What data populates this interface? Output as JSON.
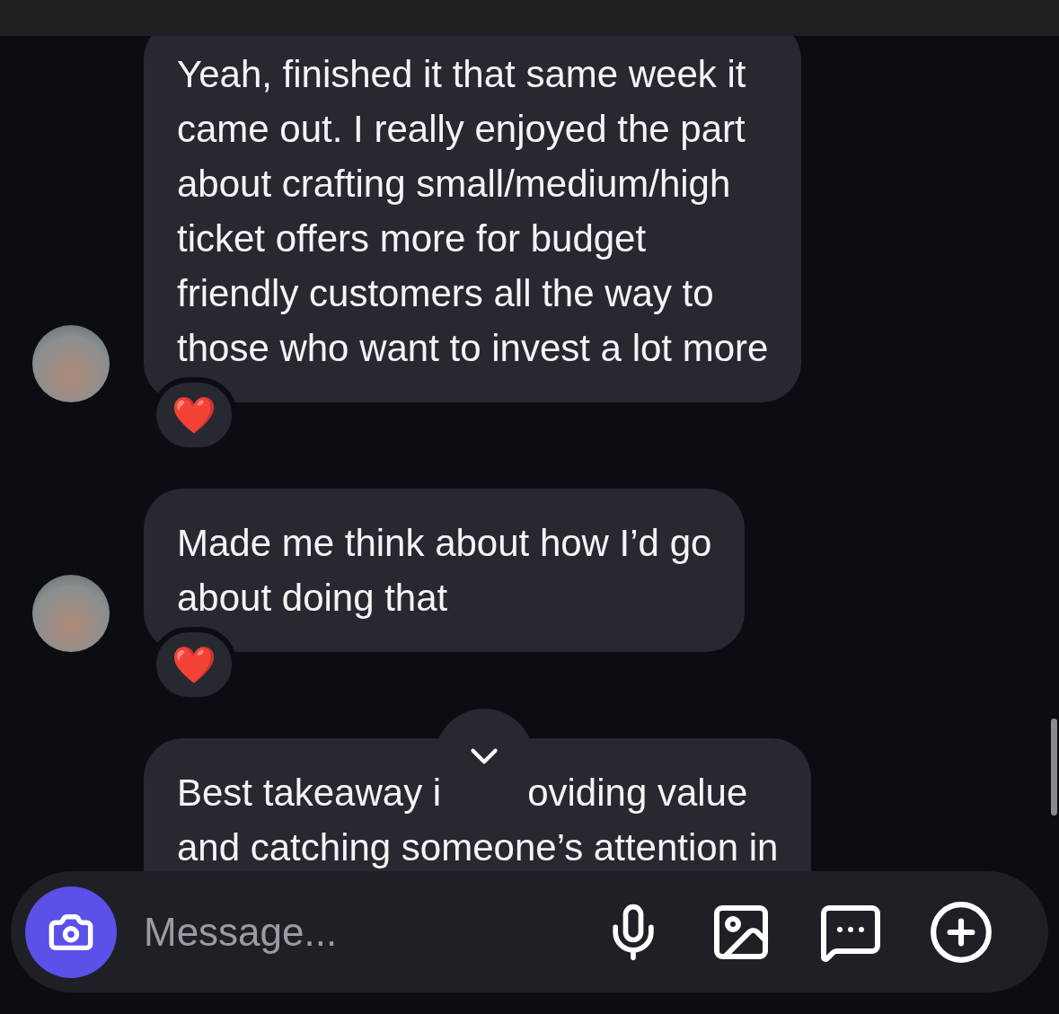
{
  "messages": [
    {
      "kind": "text",
      "text": "Yeah, finished it that same week it\ncame out. I really enjoyed the part\nabout crafting small/medium/high\nticket offers more for budget\nfriendly customers all the way to\nthose who want to invest a lot more",
      "reaction": "❤️",
      "avatar": true
    },
    {
      "kind": "text",
      "text": "Made me think about how I’d go\nabout doing that",
      "reaction": "❤️",
      "avatar": true
    },
    {
      "kind": "partly_covered",
      "fragments": [
        "Best takeaway i",
        "oviding value",
        "and catching someone’s attention in"
      ],
      "avatar": false
    }
  ],
  "composer": {
    "placeholder": "Message..."
  }
}
